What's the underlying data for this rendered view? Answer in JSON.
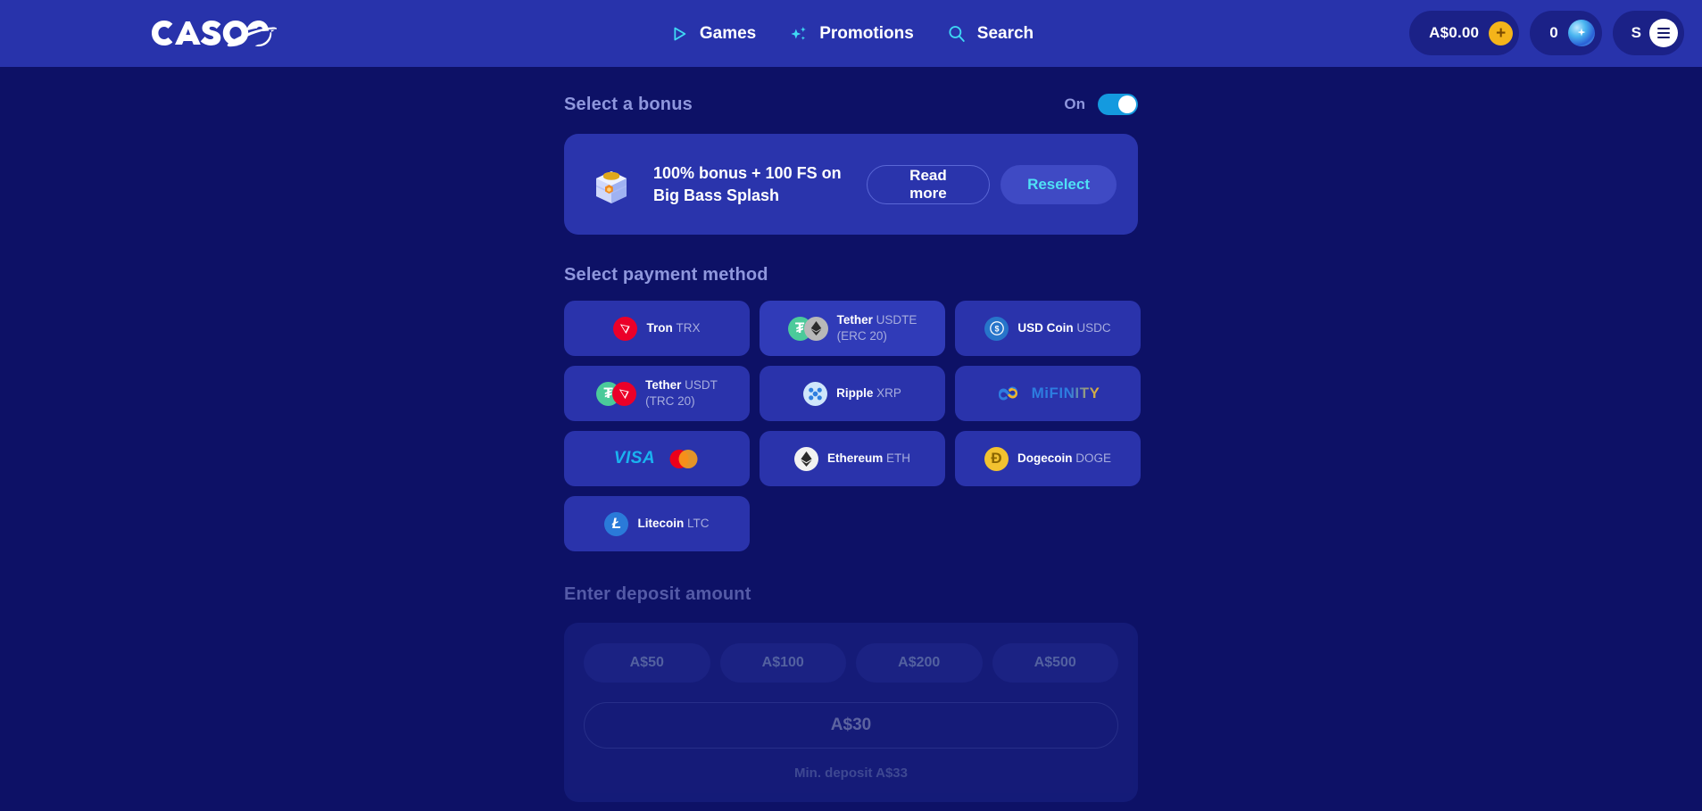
{
  "header": {
    "logo_text": "CASOO",
    "nav": [
      {
        "label": "Games",
        "icon": "play-icon"
      },
      {
        "label": "Promotions",
        "icon": "sparkles-icon"
      },
      {
        "label": "Search",
        "icon": "search-icon"
      }
    ],
    "balance": "A$0.00",
    "balance_add_icon": "plus-icon",
    "bonus_count": "0",
    "bonus_icon": "orb-icon",
    "user_initial": "S",
    "menu_icon": "hamburger-icon",
    "accent_cyan": "#4fe0f5",
    "header_bg": "#2833ab",
    "pill_bg": "#1b2187",
    "plus_badge_color": "#f4b41a"
  },
  "bonus": {
    "title": "Select a bonus",
    "toggle_label": "On",
    "toggle_on": true,
    "toggle_color": "#149adf",
    "card": {
      "icon": "money-box-icon",
      "text": "100% bonus + 100 FS on Big Bass Splash",
      "read_more_label": "Read more",
      "reselect_label": "Reselect"
    }
  },
  "payment": {
    "title": "Select payment method",
    "methods": [
      {
        "name": "Tron",
        "code": "TRX",
        "line2": "",
        "icons": [
          "tron-icon"
        ],
        "selected": false
      },
      {
        "name": "Tether",
        "code": "USDTE",
        "line2": "(ERC 20)",
        "icons": [
          "tether-icon",
          "ethereum-grey-icon"
        ],
        "selected": true
      },
      {
        "name": "USD Coin",
        "code": "USDC",
        "line2": "",
        "icons": [
          "usdc-icon"
        ],
        "selected": false
      },
      {
        "name": "Tether",
        "code": "USDT",
        "line2": "(TRC 20)",
        "icons": [
          "tether-icon",
          "tron-icon"
        ],
        "selected": false
      },
      {
        "name": "Ripple",
        "code": "XRP",
        "line2": "",
        "icons": [
          "ripple-icon"
        ],
        "selected": false
      },
      {
        "name": "MiFINITY",
        "code": "",
        "line2": "",
        "icons": [
          "mifinity-icon"
        ],
        "selected": false
      },
      {
        "name": "VISA",
        "code": "",
        "line2": "",
        "icons": [
          "visa-icon",
          "mastercard-icon"
        ],
        "selected": false
      },
      {
        "name": "Ethereum",
        "code": "ETH",
        "line2": "",
        "icons": [
          "ethereum-icon"
        ],
        "selected": false
      },
      {
        "name": "Dogecoin",
        "code": "DOGE",
        "line2": "",
        "icons": [
          "dogecoin-icon"
        ],
        "selected": false
      },
      {
        "name": "Litecoin",
        "code": "LTC",
        "line2": "",
        "icons": [
          "litecoin-icon"
        ],
        "selected": false
      }
    ]
  },
  "deposit": {
    "title": "Enter deposit amount",
    "quick_amounts": [
      "A$50",
      "A$100",
      "A$200",
      "A$500"
    ],
    "input_value": "A$30",
    "min_deposit_hint": "Min. deposit A$33"
  }
}
